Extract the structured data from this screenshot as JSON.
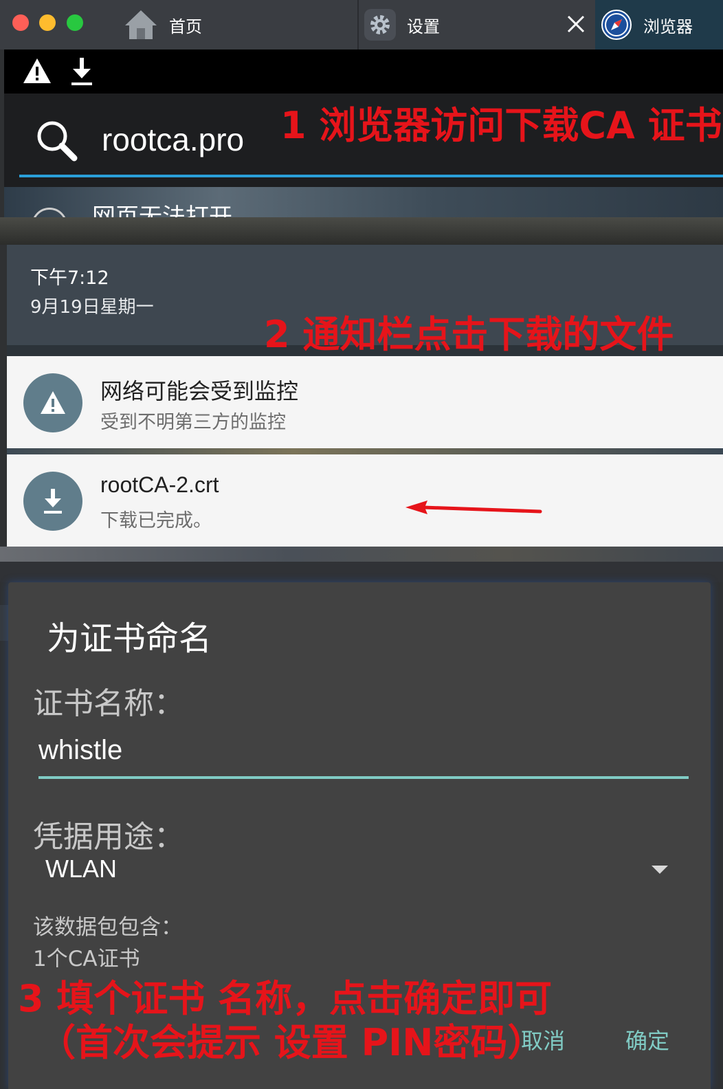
{
  "window": {
    "tabs": [
      {
        "label": "首页",
        "icon": "home-icon"
      },
      {
        "label": "设置",
        "icon": "gear-icon"
      },
      {
        "label": "浏览器",
        "icon": "compass-icon"
      }
    ]
  },
  "browser": {
    "url": "rootca.pro",
    "page_message": "网页无法打开"
  },
  "shade": {
    "time": "下午7:12",
    "date": "9月19日星期一"
  },
  "notifications": [
    {
      "title": "网络可能会受到监控",
      "text": "受到不明第三方的监控",
      "icon": "warning-icon"
    },
    {
      "title": "rootCA-2.crt",
      "text": "下载已完成。",
      "icon": "download-icon"
    }
  ],
  "dialog": {
    "title": "为证书命名",
    "name_label": "证书名称：",
    "name_value": "whistle",
    "usage_label": "凭据用途：",
    "usage_value": "WLAN",
    "info_line1": "该数据包包含：",
    "info_line2": "1个CA证书",
    "cancel": "取消",
    "ok": "确定"
  },
  "annotations": {
    "step1": "1 浏览器访问下载CA 证书",
    "step2": "2 通知栏点击下载的文件",
    "step3_line1": "3 填个证书 名称，点击确定即可",
    "step3_line2": "（首次会提示 设置 PIN密码）"
  },
  "colors": {
    "annotation": "#e6141a",
    "accent_teal": "#80cbc4",
    "url_underline": "#2a9fd8",
    "notif_icon_bg": "#607d8b"
  }
}
